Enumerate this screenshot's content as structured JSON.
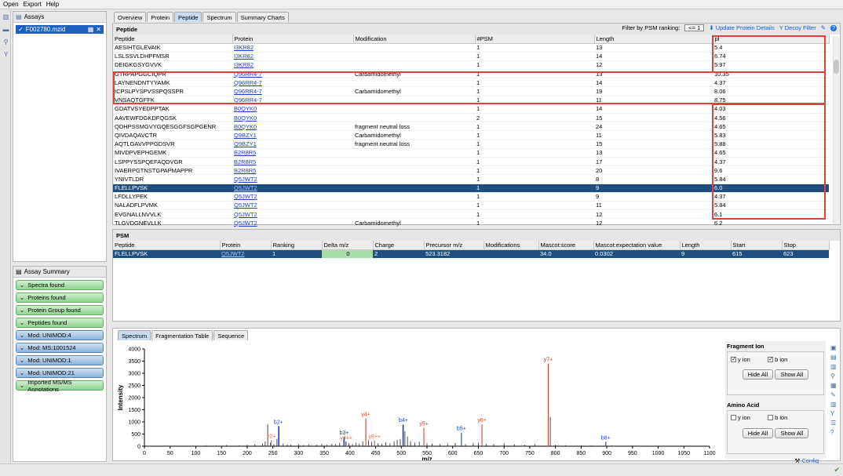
{
  "menu": [
    "Open",
    "Export",
    "Help"
  ],
  "assays": {
    "title": "Assays",
    "file": "F002780.mzid"
  },
  "summary": {
    "title": "Assay Summary",
    "items": [
      {
        "label": "Spectra found",
        "color": "green"
      },
      {
        "label": "Proteins found",
        "color": "green"
      },
      {
        "label": "Protein Group found",
        "color": "green"
      },
      {
        "label": "Peptides found",
        "color": "green"
      },
      {
        "label": "Mod: UNIMOD:4",
        "color": "blue"
      },
      {
        "label": "Mod: MS:1001524",
        "color": "blue"
      },
      {
        "label": "Mod: UNIMOD:1",
        "color": "blue"
      },
      {
        "label": "Mod: UNIMOD:21",
        "color": "blue"
      },
      {
        "label": "Imported MS/MS Annotations",
        "color": "green"
      }
    ]
  },
  "tabs": [
    "Overview",
    "Protein",
    "Peptide",
    "Spectrum",
    "Summary Charts"
  ],
  "peptide": {
    "title": "Peptide",
    "filter_label": "Filter by PSM ranking:",
    "filter_value": "<= 1",
    "update_label": "Update Protein Details",
    "decoy_label": "Decoy Filter",
    "columns": [
      "Peptide",
      "Protein",
      "Modification",
      "#PSM",
      "Length",
      "pI"
    ],
    "rows": [
      [
        "AESIHTGLEVAIK",
        "I3KR82",
        "",
        "1",
        "13",
        "5.4"
      ],
      [
        "LSLSSVLDHPFMSR",
        "I3KR82",
        "",
        "1",
        "14",
        "6.74"
      ],
      [
        "DEIGKGSYGVVK",
        "I3KR82",
        "",
        "1",
        "12",
        "5.97"
      ],
      [
        "GTRPAPGGCIQPR",
        "Q96RR4-7",
        "Carbamidomethyl",
        "1",
        "13",
        "10.35"
      ],
      [
        "LAYNENDNTYYAMK",
        "Q96RR4-7",
        "",
        "1",
        "14",
        "4.37"
      ],
      [
        "ICPSLPYSPVSSPQSSPR",
        "Q96RR4-7",
        "Carbamidomethyl",
        "1",
        "19",
        "8.06"
      ],
      [
        "VNSAQTGFFK",
        "Q96RR4-7",
        "",
        "1",
        "11",
        "8.75"
      ],
      [
        "GDATVSYEDPPTAK",
        "B0QYK0",
        "",
        "1",
        "14",
        "4.03"
      ],
      [
        "AAVEWFDGKDFQGSK",
        "B0QYK0",
        "",
        "2",
        "15",
        "4.56"
      ],
      [
        "QDHPSSMGVYGQESGGFSGPGENR",
        "B0QYK0",
        "fragment neutral loss",
        "1",
        "24",
        "4.65"
      ],
      [
        "QIVDAQAVCTR",
        "Q9BZY1",
        "Carbamidomethyl",
        "1",
        "11",
        "5.83"
      ],
      [
        "AQTLGAVVPPGDSVR",
        "Q9BZY1",
        "fragment neutral loss",
        "1",
        "15",
        "5.88"
      ],
      [
        "MIVDPVEPHGEMK",
        "B2R8R5",
        "",
        "1",
        "13",
        "4.65"
      ],
      [
        "LSPPYSSPQEFAQDVGR",
        "B2R8R5",
        "",
        "1",
        "17",
        "4.37"
      ],
      [
        "IVAERPGTNSTGPAPMAPPR",
        "B2R8R5",
        "",
        "1",
        "20",
        "9.6"
      ],
      [
        "YNIVTLDR",
        "Q5JWT2",
        "",
        "1",
        "8",
        "5.84"
      ],
      [
        "FLELLPVSK",
        "Q5JWT2",
        "",
        "1",
        "9",
        "6.0"
      ],
      [
        "LFDLLYPEK",
        "Q5JWT2",
        "",
        "1",
        "9",
        "4.37"
      ],
      [
        "NALADFLPVMK",
        "Q5JWT2",
        "",
        "1",
        "11",
        "5.84"
      ],
      [
        "EVGNALLNVVLK",
        "Q5JWT2",
        "",
        "1",
        "12",
        "6.1"
      ],
      [
        "TLGVDGNEVLLK",
        "Q5JWT2",
        "Carbamidomethyl",
        "1",
        "12",
        "6.2"
      ]
    ],
    "selected_row": 16
  },
  "psm": {
    "title": "PSM",
    "columns": [
      "Peptide",
      "Protein",
      "Ranking",
      "Delta m/z",
      "Charge",
      "Precursor m/z",
      "Modifications",
      "Mascot:score",
      "Mascot:expectation value",
      "Length",
      "Start",
      "Stop"
    ],
    "rows": [
      [
        "FLELLPVSK",
        "Q5JWT2",
        "1",
        "0",
        "2",
        "523.3182",
        "",
        "34.0",
        "0.0302",
        "9",
        "615",
        "623"
      ]
    ]
  },
  "spectrum": {
    "tabs": [
      "Spectrum",
      "Fragmentation Table",
      "Sequence"
    ]
  },
  "fragment_ion": {
    "title": "Fragment Ion",
    "y_label": "y ion",
    "b_label": "b ion",
    "hide": "Hide All",
    "show": "Show All"
  },
  "amino_acid": {
    "title": "Amino Acid",
    "y_label": "y ion",
    "b_label": "b ion",
    "hide": "Hide All",
    "show": "Show All",
    "config": "Config"
  },
  "chart_data": {
    "type": "bar",
    "xlabel": "m/z",
    "ylabel": "Intensity",
    "xlim": [
      0,
      1100
    ],
    "ylim": [
      0,
      4000
    ],
    "x_ticks": [
      0,
      50,
      100,
      150,
      200,
      250,
      300,
      350,
      400,
      450,
      500,
      550,
      600,
      650,
      700,
      750,
      800,
      850,
      900,
      950,
      1000,
      1050,
      1100
    ],
    "y_ticks": [
      0,
      500,
      1000,
      1500,
      2000,
      2500,
      3000,
      3500,
      4000
    ],
    "annotations": [
      {
        "label": "y2+",
        "x": 247,
        "y": 250,
        "color": "#e06a3a"
      },
      {
        "label": "b2+",
        "x": 261,
        "y": 830,
        "color": "#2040d0"
      },
      {
        "label": "b3+",
        "x": 389,
        "y": 380,
        "color": "#2040d0"
      },
      {
        "label": "y3++",
        "x": 393,
        "y": 180,
        "color": "#e06a3a"
      },
      {
        "label": "y4+",
        "x": 431,
        "y": 1150,
        "color": "#d04020"
      },
      {
        "label": "y8++",
        "x": 448,
        "y": 220,
        "color": "#e06a3a"
      },
      {
        "label": "b4+",
        "x": 504,
        "y": 900,
        "color": "#2040d0"
      },
      {
        "label": "y5+",
        "x": 544,
        "y": 760,
        "color": "#d04020"
      },
      {
        "label": "b5+",
        "x": 617,
        "y": 560,
        "color": "#2040d0"
      },
      {
        "label": "y6+",
        "x": 657,
        "y": 900,
        "color": "#d04020"
      },
      {
        "label": "y7+",
        "x": 786,
        "y": 3400,
        "color": "#d04020"
      },
      {
        "label": "b8+",
        "x": 898,
        "y": 180,
        "color": "#2040d0"
      }
    ],
    "peaks": [
      [
        120,
        40
      ],
      [
        140,
        30
      ],
      [
        160,
        50
      ],
      [
        185,
        35
      ],
      [
        200,
        60
      ],
      [
        215,
        80
      ],
      [
        230,
        120
      ],
      [
        235,
        200
      ],
      [
        240,
        900
      ],
      [
        245,
        150
      ],
      [
        252,
        90
      ],
      [
        258,
        300
      ],
      [
        262,
        820
      ],
      [
        270,
        110
      ],
      [
        278,
        70
      ],
      [
        285,
        60
      ],
      [
        300,
        80
      ],
      [
        310,
        50
      ],
      [
        320,
        70
      ],
      [
        335,
        60
      ],
      [
        345,
        90
      ],
      [
        355,
        60
      ],
      [
        365,
        100
      ],
      [
        372,
        80
      ],
      [
        380,
        140
      ],
      [
        388,
        360
      ],
      [
        392,
        200
      ],
      [
        398,
        120
      ],
      [
        405,
        90
      ],
      [
        412,
        150
      ],
      [
        418,
        110
      ],
      [
        425,
        200
      ],
      [
        431,
        1100
      ],
      [
        436,
        250
      ],
      [
        442,
        180
      ],
      [
        448,
        220
      ],
      [
        455,
        130
      ],
      [
        462,
        100
      ],
      [
        470,
        160
      ],
      [
        478,
        120
      ],
      [
        486,
        200
      ],
      [
        492,
        260
      ],
      [
        498,
        300
      ],
      [
        503,
        880
      ],
      [
        507,
        620
      ],
      [
        512,
        400
      ],
      [
        518,
        200
      ],
      [
        526,
        150
      ],
      [
        535,
        180
      ],
      [
        544,
        750
      ],
      [
        550,
        120
      ],
      [
        560,
        100
      ],
      [
        575,
        90
      ],
      [
        590,
        110
      ],
      [
        605,
        130
      ],
      [
        617,
        550
      ],
      [
        625,
        90
      ],
      [
        640,
        120
      ],
      [
        650,
        140
      ],
      [
        657,
        880
      ],
      [
        665,
        100
      ],
      [
        680,
        90
      ],
      [
        700,
        120
      ],
      [
        720,
        80
      ],
      [
        740,
        60
      ],
      [
        760,
        90
      ],
      [
        786,
        3400
      ],
      [
        790,
        1200
      ],
      [
        800,
        60
      ],
      [
        820,
        40
      ],
      [
        850,
        35
      ],
      [
        870,
        30
      ],
      [
        898,
        170
      ],
      [
        910,
        30
      ],
      [
        950,
        25
      ]
    ]
  }
}
